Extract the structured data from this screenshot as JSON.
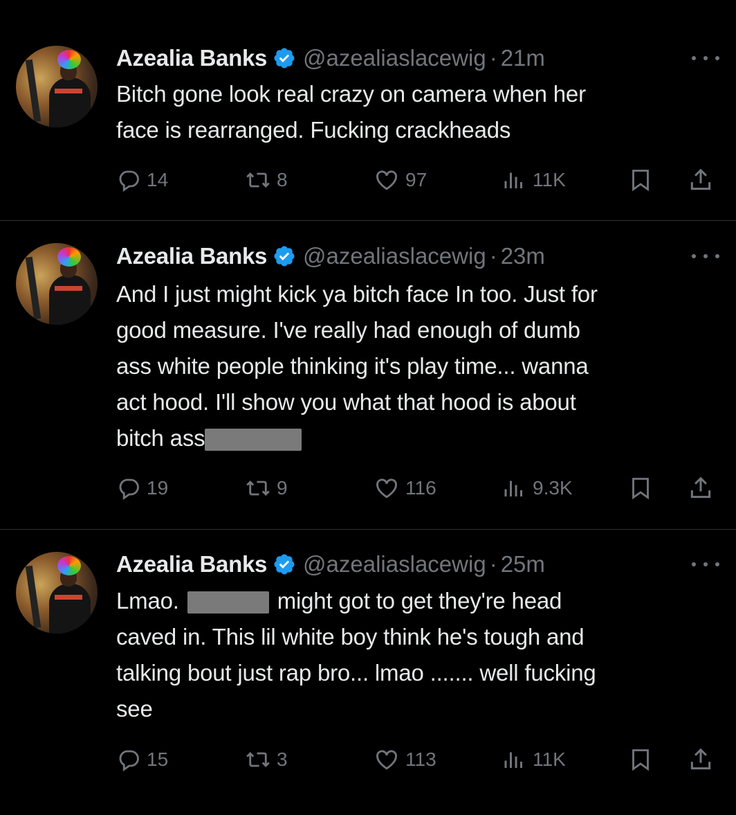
{
  "tweets": [
    {
      "author": "Azealia Banks",
      "handle": "@azealiaslacewig",
      "separator": "·",
      "time": "21m",
      "lines": [
        "Bitch gone look real crazy on camera when her",
        "face is rearranged. Fucking crackheads"
      ],
      "replies": "14",
      "reposts": "8",
      "likes": "97",
      "views": "11K"
    },
    {
      "author": "Azealia Banks",
      "handle": "@azealiaslacewig",
      "separator": "·",
      "time": "23m",
      "lines": [
        "And I just might kick ya bitch face In too. Just for",
        "good measure. I've really had enough of dumb",
        "ass white people thinking it's play time... wanna",
        "act hood. I'll show you what that hood is about",
        "bitch ass"
      ],
      "replies": "19",
      "reposts": "9",
      "likes": "116",
      "views": "9.3K"
    },
    {
      "author": "Azealia Banks",
      "handle": "@azealiaslacewig",
      "separator": "·",
      "time": "25m",
      "line1_before": "Lmao.",
      "line1_after": "might got to get they're head",
      "lines": [
        "",
        "caved in. This lil white boy think he's tough and",
        "talking bout just rap bro... lmao ....... well fucking",
        "see"
      ],
      "replies": "15",
      "reposts": "3",
      "likes": "113",
      "views": "11K"
    }
  ],
  "icons": {
    "verified": "verified-badge-icon",
    "more": "more-dots-icon",
    "reply": "reply-bubble-icon",
    "repost": "repost-arrows-icon",
    "like": "heart-icon",
    "views": "views-bars-icon",
    "bookmark": "bookmark-icon",
    "share": "share-upload-icon"
  },
  "colors": {
    "background": "#000000",
    "text": "#e7e9ea",
    "muted": "#71767b",
    "verified": "#1d9bf0"
  }
}
